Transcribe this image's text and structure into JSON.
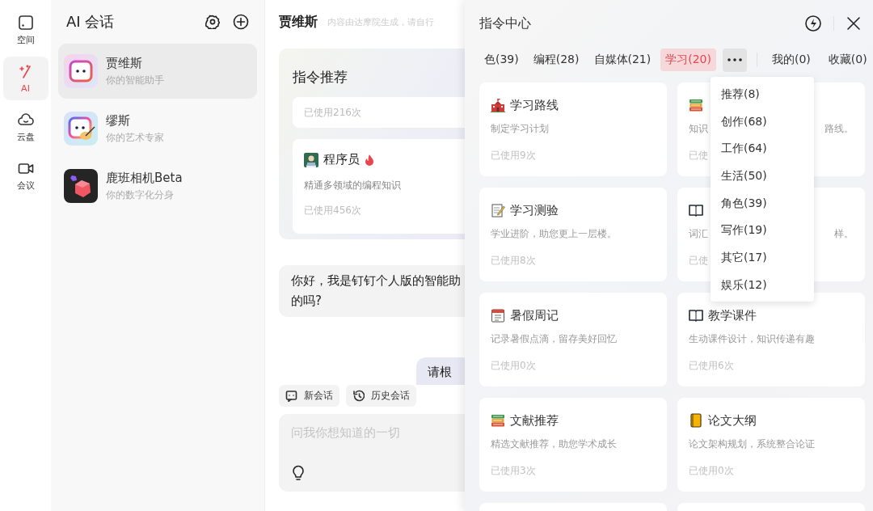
{
  "nav_rail": {
    "items": [
      {
        "label": "空间",
        "kind": "space",
        "selected": false
      },
      {
        "label": "AI",
        "kind": "wand",
        "selected": true
      },
      {
        "label": "云盘",
        "kind": "cloud",
        "selected": false
      },
      {
        "label": "会议",
        "kind": "camera",
        "selected": false
      }
    ]
  },
  "conversations": {
    "title": "AI 会话",
    "items": [
      {
        "name": "贾维斯",
        "subtitle": "你的智能助手",
        "kind": "robot",
        "selected": true
      },
      {
        "name": "缪斯",
        "subtitle": "你的艺术专家",
        "kind": "artist",
        "selected": false
      },
      {
        "name": "鹿班相机Beta",
        "subtitle": "你的数字化分身",
        "kind": "cube",
        "selected": false
      }
    ]
  },
  "chat": {
    "title": "贾维斯",
    "notice": "内容由达摩院生成，请自行",
    "recommend": {
      "title": "指令推荐",
      "cards": [
        {
          "usage": "已使用216次"
        },
        {
          "kind": "programmer",
          "title": "程序员",
          "hot": true,
          "desc": "精通多领域的编程知识",
          "usage": "已使用456次"
        }
      ]
    },
    "messages": [
      {
        "kind": "assistant",
        "lines": [
          "你好，我是钉钉个人版的智能助",
          "的吗?"
        ]
      },
      {
        "kind": "user",
        "lines": [
          "请根"
        ]
      }
    ],
    "actions": [
      {
        "label": "新会话",
        "kind": "chat"
      },
      {
        "label": "历史会话",
        "kind": "history"
      }
    ],
    "input": {
      "placeholder": "问我你想知道的一切"
    }
  },
  "command_center": {
    "title": "指令中心",
    "tabs": [
      {
        "label": "色(39)",
        "selected": false
      },
      {
        "label": "编程(28)",
        "selected": false
      },
      {
        "label": "自媒体(21)",
        "selected": false
      },
      {
        "label": "学习(20)",
        "selected": true
      }
    ],
    "more_expanded": true,
    "my_tabs": [
      {
        "label": "我的(0)",
        "selected": false
      },
      {
        "label": "收藏(0)",
        "selected": false
      }
    ],
    "menu": [
      "推荐(8)",
      "创作(68)",
      "工作(64)",
      "生活(50)",
      "角色(39)",
      "写作(19)",
      "其它(17)",
      "娱乐(12)"
    ],
    "cards": [
      {
        "kind": "school",
        "title": "学习路线",
        "desc": "制定学习计划",
        "usage": "已使用9次"
      },
      {
        "kind": "books",
        "desc": "知识",
        "desc_end": "路线。",
        "usage": "已使"
      },
      {
        "kind": "memo",
        "title": "学习测验",
        "desc": "学业进阶，助您更上一层楼。",
        "usage": "已使用8次"
      },
      {
        "kind": "book",
        "desc": "词汇",
        "desc_end": "样。",
        "usage": "已使"
      },
      {
        "kind": "calendar",
        "title": "暑假周记",
        "desc": "记录暑假点滴，留存美好回忆",
        "usage": "已使用0次"
      },
      {
        "kind": "book",
        "title": "教学课件",
        "desc": "生动课件设计，知识传递有趣",
        "usage": "已使用6次"
      },
      {
        "kind": "books",
        "title": "文献推荐",
        "desc": "精选文献推荐，助您学术成长",
        "usage": "已使用3次"
      },
      {
        "kind": "notebook",
        "title": "论文大纲",
        "desc": "论文架构规划，系统整合论证",
        "usage": "已使用0次"
      },
      {
        "kind": "cut"
      },
      {
        "kind": "cut"
      }
    ]
  }
}
